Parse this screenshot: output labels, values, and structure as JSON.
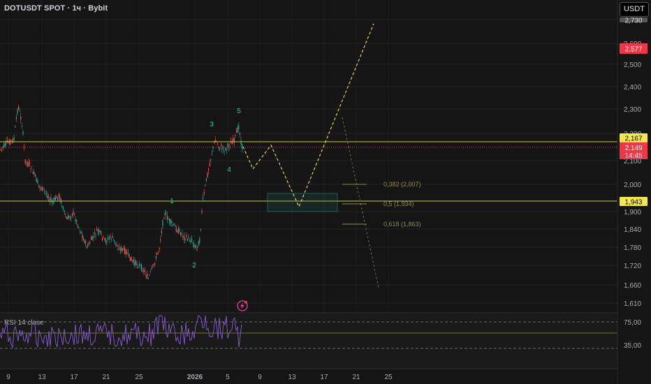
{
  "header": {
    "symbol_title": "DOTUSDT SPOT · 1ч · Bybit",
    "currency_button": "USDT"
  },
  "price_axis": {
    "ticks": [
      "2,700",
      "2,600",
      "2,500",
      "2,400",
      "2,300",
      "2,200",
      "2,100",
      "2,000",
      "1,900",
      "1,840",
      "1,780",
      "1,720",
      "1,660",
      "1,610"
    ]
  },
  "price_badges": {
    "level_upper": "2,167",
    "current_price": "2,149",
    "countdown": "14:45",
    "level_lower": "1,943",
    "target_high": "2,577",
    "top_partial": "2,730"
  },
  "time_axis": {
    "ticks": [
      "9",
      "13",
      "17",
      "21",
      "25",
      "2026",
      "5",
      "9",
      "13",
      "17",
      "21",
      "25"
    ]
  },
  "waves": {
    "labels": [
      "1",
      "2",
      "3",
      "4",
      "5"
    ]
  },
  "fibonacci": {
    "levels": [
      "0,382 (2,007)",
      "0,5 (1,934)",
      "0,618 (1,863)"
    ]
  },
  "rsi": {
    "title": "RSI 14 close",
    "ticks": [
      "75,00",
      "35,00"
    ]
  },
  "colors": {
    "background": "#151515",
    "bull": "#26a69a",
    "bear": "#ef5350",
    "level_line": "#c8c840",
    "projection": "#e6d44a",
    "rsi_line": "#7e57c2",
    "badge_yellow": "#f5e74b",
    "badge_red": "#f23645"
  }
}
